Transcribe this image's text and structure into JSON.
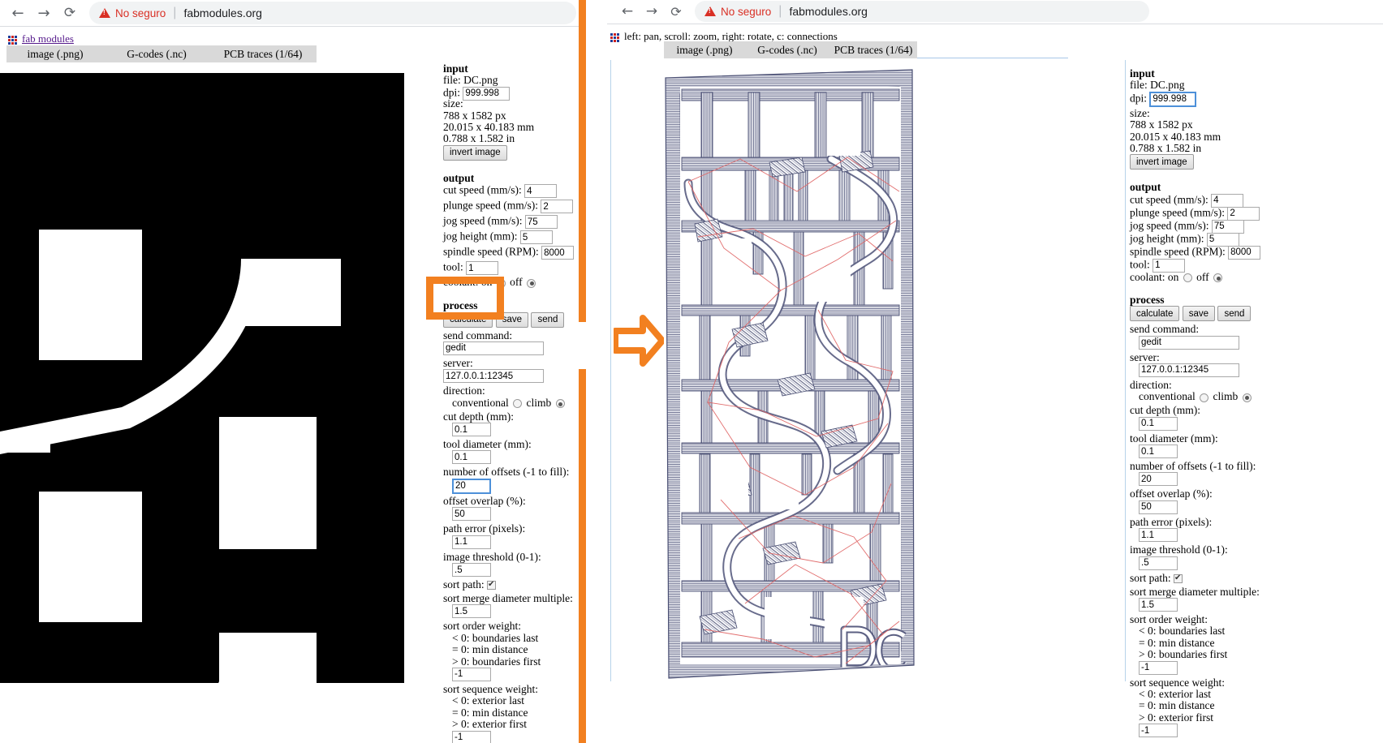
{
  "browser": {
    "back_icon": "arrow-left-icon",
    "forward_icon": "arrow-right-icon",
    "reload_icon": "reload-icon",
    "warning_icon": "warning-triangle-icon",
    "security_label": "No seguro",
    "url": "fabmodules.org"
  },
  "left_panel": {
    "app_title": "fab modules",
    "tabs": [
      {
        "label": "image (.png)"
      },
      {
        "label": "G-codes (.nc)"
      },
      {
        "label": "PCB traces (1/64)"
      }
    ]
  },
  "right_panel": {
    "hint": "left: pan, scroll: zoom, right: rotate, c: connections",
    "tabs": [
      {
        "label": "image (.png)"
      },
      {
        "label": "G-codes (.nc)"
      },
      {
        "label": "PCB traces (1/64)"
      }
    ]
  },
  "form": {
    "input": {
      "heading": "input",
      "file_label": "file: DC.png",
      "dpi_label": "dpi:",
      "dpi_value": "999.998",
      "size_label": "size:",
      "size_px": "788 x 1582 px",
      "size_mm": "20.015 x 40.183 mm",
      "size_in": "0.788 x 1.582 in",
      "invert_button": "invert image"
    },
    "output": {
      "heading": "output",
      "cut_speed_label": "cut speed (mm/s):",
      "cut_speed_value": "4",
      "plunge_speed_label": "plunge speed (mm/s):",
      "plunge_speed_value": "2",
      "jog_speed_label": "jog speed (mm/s):",
      "jog_speed_value": "75",
      "jog_height_label": "jog height (mm):",
      "jog_height_value": "5",
      "spindle_speed_label": "spindle speed (RPM):",
      "spindle_speed_value": "8000",
      "tool_label": "tool:",
      "tool_value": "1",
      "coolant_label": "coolant:",
      "coolant_on_label": "on",
      "coolant_off_label": "off",
      "coolant_selected": "off"
    },
    "process": {
      "heading": "process",
      "calculate_button": "calculate",
      "save_button": "save",
      "send_button": "send",
      "send_command_label": "send command:",
      "send_command_value": "gedit",
      "server_label": "server:",
      "server_value": "127.0.0.1:12345",
      "direction_label": "direction:",
      "direction_conventional": "conventional",
      "direction_climb": "climb",
      "direction_selected": "climb",
      "cut_depth_label": "cut depth (mm):",
      "cut_depth_value": "0.1",
      "tool_diameter_label": "tool diameter (mm):",
      "tool_diameter_value": "0.1",
      "offsets_label": "number of offsets (-1 to fill):",
      "offsets_value": "20",
      "overlap_label": "offset overlap (%):",
      "overlap_value": "50",
      "path_error_label": "path error (pixels):",
      "path_error_value": "1.1",
      "threshold_label": "image threshold (0-1):",
      "threshold_value": ".5",
      "sort_path_label": "sort path:",
      "sort_path_checked": "true",
      "sort_merge_label": "sort merge diameter multiple:",
      "sort_merge_value": "1.5",
      "sort_order_label": "sort order weight:",
      "sort_order_lt": "< 0: boundaries last",
      "sort_order_eq": "= 0: min distance",
      "sort_order_gt": "> 0: boundaries first",
      "sort_order_value": "-1",
      "sort_sequence_label": "sort sequence weight:",
      "sort_sequence_lt": "< 0: exterior last",
      "sort_sequence_eq": "= 0: min distance",
      "sort_sequence_gt": "> 0: exterior first",
      "sort_sequence_value": "-1"
    }
  },
  "annotations": {
    "highlight_color": "#f28020",
    "arrow_name": "step-arrow",
    "box_name": "calculate-highlight-box"
  },
  "colors": {
    "toolpath_stroke": "#5b5f82",
    "jog_stroke": "#e06666",
    "tab_bg": "#d9d9d9",
    "warning_red": "#d93025"
  }
}
